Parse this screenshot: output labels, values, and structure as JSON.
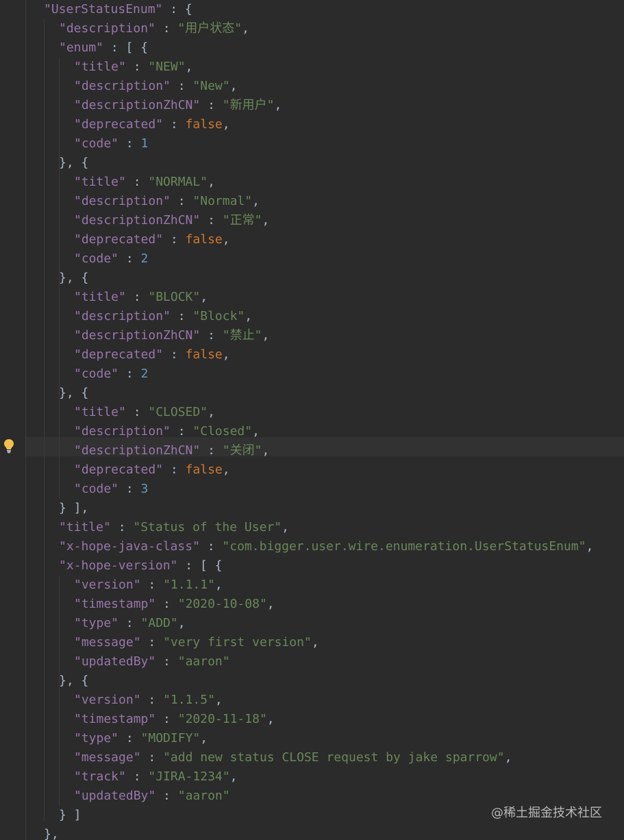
{
  "colors": {
    "background": "#2b2b2b",
    "key": "#9876aa",
    "string": "#6a8759",
    "keyword": "#cc7832",
    "number": "#6897bb",
    "punctuation": "#a9b7c6"
  },
  "icons": {
    "gutter_intention": "lightbulb-icon"
  },
  "watermark": "@稀土掘金技术社区",
  "lines": [
    {
      "indent": 0,
      "parts": [
        {
          "t": "k",
          "v": "\"UserStatusEnum\""
        },
        {
          "t": "p",
          "v": " : {"
        }
      ]
    },
    {
      "indent": 1,
      "parts": [
        {
          "t": "k",
          "v": "\"description\""
        },
        {
          "t": "p",
          "v": " : "
        },
        {
          "t": "s",
          "v": "\"用户状态\""
        },
        {
          "t": "p",
          "v": ","
        }
      ]
    },
    {
      "indent": 1,
      "parts": [
        {
          "t": "k",
          "v": "\"enum\""
        },
        {
          "t": "p",
          "v": " : [ {"
        }
      ]
    },
    {
      "indent": 2,
      "parts": [
        {
          "t": "k",
          "v": "\"title\""
        },
        {
          "t": "p",
          "v": " : "
        },
        {
          "t": "s",
          "v": "\"NEW\""
        },
        {
          "t": "p",
          "v": ","
        }
      ]
    },
    {
      "indent": 2,
      "parts": [
        {
          "t": "k",
          "v": "\"description\""
        },
        {
          "t": "p",
          "v": " : "
        },
        {
          "t": "s",
          "v": "\"New\""
        },
        {
          "t": "p",
          "v": ","
        }
      ]
    },
    {
      "indent": 2,
      "parts": [
        {
          "t": "k",
          "v": "\"descriptionZhCN\""
        },
        {
          "t": "p",
          "v": " : "
        },
        {
          "t": "s",
          "v": "\"新用户\""
        },
        {
          "t": "p",
          "v": ","
        }
      ]
    },
    {
      "indent": 2,
      "parts": [
        {
          "t": "k",
          "v": "\"deprecated\""
        },
        {
          "t": "p",
          "v": " : "
        },
        {
          "t": "kw",
          "v": "false"
        },
        {
          "t": "p",
          "v": ","
        }
      ]
    },
    {
      "indent": 2,
      "parts": [
        {
          "t": "k",
          "v": "\"code\""
        },
        {
          "t": "p",
          "v": " : "
        },
        {
          "t": "n",
          "v": "1"
        }
      ]
    },
    {
      "indent": 1,
      "parts": [
        {
          "t": "p",
          "v": "}, {"
        }
      ]
    },
    {
      "indent": 2,
      "parts": [
        {
          "t": "k",
          "v": "\"title\""
        },
        {
          "t": "p",
          "v": " : "
        },
        {
          "t": "s",
          "v": "\"NORMAL\""
        },
        {
          "t": "p",
          "v": ","
        }
      ]
    },
    {
      "indent": 2,
      "parts": [
        {
          "t": "k",
          "v": "\"description\""
        },
        {
          "t": "p",
          "v": " : "
        },
        {
          "t": "s",
          "v": "\"Normal\""
        },
        {
          "t": "p",
          "v": ","
        }
      ]
    },
    {
      "indent": 2,
      "parts": [
        {
          "t": "k",
          "v": "\"descriptionZhCN\""
        },
        {
          "t": "p",
          "v": " : "
        },
        {
          "t": "s",
          "v": "\"正常\""
        },
        {
          "t": "p",
          "v": ","
        }
      ]
    },
    {
      "indent": 2,
      "parts": [
        {
          "t": "k",
          "v": "\"deprecated\""
        },
        {
          "t": "p",
          "v": " : "
        },
        {
          "t": "kw",
          "v": "false"
        },
        {
          "t": "p",
          "v": ","
        }
      ]
    },
    {
      "indent": 2,
      "parts": [
        {
          "t": "k",
          "v": "\"code\""
        },
        {
          "t": "p",
          "v": " : "
        },
        {
          "t": "n",
          "v": "2"
        }
      ]
    },
    {
      "indent": 1,
      "parts": [
        {
          "t": "p",
          "v": "}, {"
        }
      ]
    },
    {
      "indent": 2,
      "parts": [
        {
          "t": "k",
          "v": "\"title\""
        },
        {
          "t": "p",
          "v": " : "
        },
        {
          "t": "s",
          "v": "\"BLOCK\""
        },
        {
          "t": "p",
          "v": ","
        }
      ]
    },
    {
      "indent": 2,
      "parts": [
        {
          "t": "k",
          "v": "\"description\""
        },
        {
          "t": "p",
          "v": " : "
        },
        {
          "t": "s",
          "v": "\"Block\""
        },
        {
          "t": "p",
          "v": ","
        }
      ]
    },
    {
      "indent": 2,
      "parts": [
        {
          "t": "k",
          "v": "\"descriptionZhCN\""
        },
        {
          "t": "p",
          "v": " : "
        },
        {
          "t": "s",
          "v": "\"禁止\""
        },
        {
          "t": "p",
          "v": ","
        }
      ]
    },
    {
      "indent": 2,
      "parts": [
        {
          "t": "k",
          "v": "\"deprecated\""
        },
        {
          "t": "p",
          "v": " : "
        },
        {
          "t": "kw",
          "v": "false"
        },
        {
          "t": "p",
          "v": ","
        }
      ]
    },
    {
      "indent": 2,
      "parts": [
        {
          "t": "k",
          "v": "\"code\""
        },
        {
          "t": "p",
          "v": " : "
        },
        {
          "t": "n",
          "v": "2"
        }
      ]
    },
    {
      "indent": 1,
      "parts": [
        {
          "t": "p",
          "v": "}, {"
        }
      ]
    },
    {
      "indent": 2,
      "parts": [
        {
          "t": "k",
          "v": "\"title\""
        },
        {
          "t": "p",
          "v": " : "
        },
        {
          "t": "s",
          "v": "\"CLOSED\""
        },
        {
          "t": "p",
          "v": ","
        }
      ]
    },
    {
      "indent": 2,
      "parts": [
        {
          "t": "k",
          "v": "\"description\""
        },
        {
          "t": "p",
          "v": " : "
        },
        {
          "t": "s",
          "v": "\"Closed\""
        },
        {
          "t": "p",
          "v": ","
        }
      ]
    },
    {
      "indent": 2,
      "current": true,
      "parts": [
        {
          "t": "k",
          "v": "\"descriptionZhCN\""
        },
        {
          "t": "p",
          "v": " : "
        },
        {
          "t": "s",
          "v": "\"关闭\""
        },
        {
          "t": "p",
          "v": ","
        }
      ]
    },
    {
      "indent": 2,
      "parts": [
        {
          "t": "k",
          "v": "\"deprecated\""
        },
        {
          "t": "p",
          "v": " : "
        },
        {
          "t": "kw",
          "v": "false"
        },
        {
          "t": "p",
          "v": ","
        }
      ]
    },
    {
      "indent": 2,
      "parts": [
        {
          "t": "k",
          "v": "\"code\""
        },
        {
          "t": "p",
          "v": " : "
        },
        {
          "t": "n",
          "v": "3"
        }
      ]
    },
    {
      "indent": 1,
      "parts": [
        {
          "t": "p",
          "v": "} ],"
        }
      ]
    },
    {
      "indent": 1,
      "parts": [
        {
          "t": "k",
          "v": "\"title\""
        },
        {
          "t": "p",
          "v": " : "
        },
        {
          "t": "s",
          "v": "\"Status of the User\""
        },
        {
          "t": "p",
          "v": ","
        }
      ]
    },
    {
      "indent": 1,
      "parts": [
        {
          "t": "k",
          "v": "\"x-hope-java-class\""
        },
        {
          "t": "p",
          "v": " : "
        },
        {
          "t": "s",
          "v": "\"com.bigger.user.wire.enumeration.UserStatusEnum\""
        },
        {
          "t": "p",
          "v": ","
        }
      ]
    },
    {
      "indent": 1,
      "parts": [
        {
          "t": "k",
          "v": "\"x-hope-version\""
        },
        {
          "t": "p",
          "v": " : [ {"
        }
      ]
    },
    {
      "indent": 2,
      "parts": [
        {
          "t": "k",
          "v": "\"version\""
        },
        {
          "t": "p",
          "v": " : "
        },
        {
          "t": "s",
          "v": "\"1.1.1\""
        },
        {
          "t": "p",
          "v": ","
        }
      ]
    },
    {
      "indent": 2,
      "parts": [
        {
          "t": "k",
          "v": "\"timestamp\""
        },
        {
          "t": "p",
          "v": " : "
        },
        {
          "t": "s",
          "v": "\"2020-10-08\""
        },
        {
          "t": "p",
          "v": ","
        }
      ]
    },
    {
      "indent": 2,
      "parts": [
        {
          "t": "k",
          "v": "\"type\""
        },
        {
          "t": "p",
          "v": " : "
        },
        {
          "t": "s",
          "v": "\"ADD\""
        },
        {
          "t": "p",
          "v": ","
        }
      ]
    },
    {
      "indent": 2,
      "parts": [
        {
          "t": "k",
          "v": "\"message\""
        },
        {
          "t": "p",
          "v": " : "
        },
        {
          "t": "s",
          "v": "\"very first version\""
        },
        {
          "t": "p",
          "v": ","
        }
      ]
    },
    {
      "indent": 2,
      "parts": [
        {
          "t": "k",
          "v": "\"updatedBy\""
        },
        {
          "t": "p",
          "v": " : "
        },
        {
          "t": "s",
          "v": "\"aaron\""
        }
      ]
    },
    {
      "indent": 1,
      "parts": [
        {
          "t": "p",
          "v": "}, {"
        }
      ]
    },
    {
      "indent": 2,
      "parts": [
        {
          "t": "k",
          "v": "\"version\""
        },
        {
          "t": "p",
          "v": " : "
        },
        {
          "t": "s",
          "v": "\"1.1.5\""
        },
        {
          "t": "p",
          "v": ","
        }
      ]
    },
    {
      "indent": 2,
      "parts": [
        {
          "t": "k",
          "v": "\"timestamp\""
        },
        {
          "t": "p",
          "v": " : "
        },
        {
          "t": "s",
          "v": "\"2020-11-18\""
        },
        {
          "t": "p",
          "v": ","
        }
      ]
    },
    {
      "indent": 2,
      "parts": [
        {
          "t": "k",
          "v": "\"type\""
        },
        {
          "t": "p",
          "v": " : "
        },
        {
          "t": "s",
          "v": "\"MODIFY\""
        },
        {
          "t": "p",
          "v": ","
        }
      ]
    },
    {
      "indent": 2,
      "parts": [
        {
          "t": "k",
          "v": "\"message\""
        },
        {
          "t": "p",
          "v": " : "
        },
        {
          "t": "s",
          "v": "\"add new status CLOSE request by jake sparrow\""
        },
        {
          "t": "p",
          "v": ","
        }
      ]
    },
    {
      "indent": 2,
      "parts": [
        {
          "t": "k",
          "v": "\"track\""
        },
        {
          "t": "p",
          "v": " : "
        },
        {
          "t": "s",
          "v": "\"JIRA-1234\""
        },
        {
          "t": "p",
          "v": ","
        }
      ]
    },
    {
      "indent": 2,
      "parts": [
        {
          "t": "k",
          "v": "\"updatedBy\""
        },
        {
          "t": "p",
          "v": " : "
        },
        {
          "t": "s",
          "v": "\"aaron\""
        }
      ]
    },
    {
      "indent": 1,
      "parts": [
        {
          "t": "p",
          "v": "} ]"
        }
      ]
    },
    {
      "indent": 0,
      "parts": [
        {
          "t": "p",
          "v": "},"
        }
      ]
    }
  ]
}
